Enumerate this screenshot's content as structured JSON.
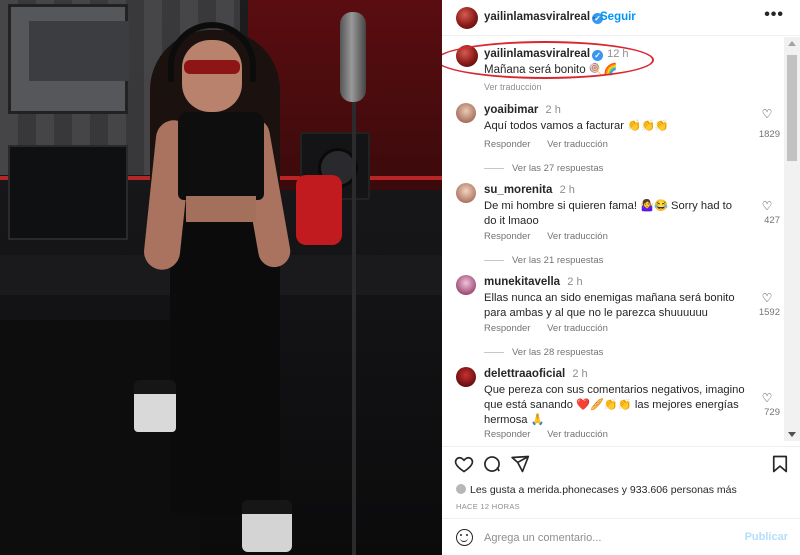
{
  "post": {
    "username": "yailinlamasviralreal",
    "follow_label": "Seguir",
    "more_label": "•••",
    "verified_mark": "✓"
  },
  "caption": {
    "username": "yailinlamasviralreal",
    "time": "12 h",
    "text": "Mañana será bonito 🍭🌈",
    "translation": "Ver traducción"
  },
  "comments": [
    {
      "username": "yoaibimar",
      "time": "2 h",
      "text": "Aquí todos vamos a facturar 👏👏👏",
      "reply": "Responder",
      "translate": "Ver traducción",
      "likes": "1829",
      "replies": "Ver las 27 respuestas"
    },
    {
      "username": "su_morenita",
      "time": "2 h",
      "text": "De mi hombre si quieren fama! 🤷‍♀️😂 Sorry had to do it lmaoo",
      "reply": "Responder",
      "translate": "Ver traducción",
      "likes": "427",
      "replies": "Ver las 21 respuestas"
    },
    {
      "username": "munekitavella",
      "time": "2 h",
      "text": "Ellas nunca an sido enemigas mañana será bonito para ambas y al que no le parezca shuuuuuu",
      "reply": "Responder",
      "translate": "Ver traducción",
      "likes": "1592",
      "replies": "Ver las 28 respuestas"
    },
    {
      "username": "delettraaoficial",
      "time": "2 h",
      "text": "Que pereza con sus comentarios negativos, imagino que está sanando ❤️🥖👏👏 las mejores energías hermosa 🙏",
      "reply": "Responder",
      "translate": "Ver traducción",
      "likes": "729"
    }
  ],
  "likes_line": "Les gusta a merida.phonecases y 933.606 personas más",
  "time_ago": "HACE 12 HORAS",
  "add_comment": {
    "placeholder": "Agrega un comentario...",
    "post_label": "Publicar"
  },
  "colors": {
    "accent": "#0095f6",
    "highlight_ring": "#d92730",
    "post_disabled": "#b2dffc"
  },
  "icons": [
    "heart-icon",
    "comment-icon",
    "share-icon",
    "bookmark-icon",
    "emoji-icon",
    "more-icon",
    "verified-icon"
  ]
}
